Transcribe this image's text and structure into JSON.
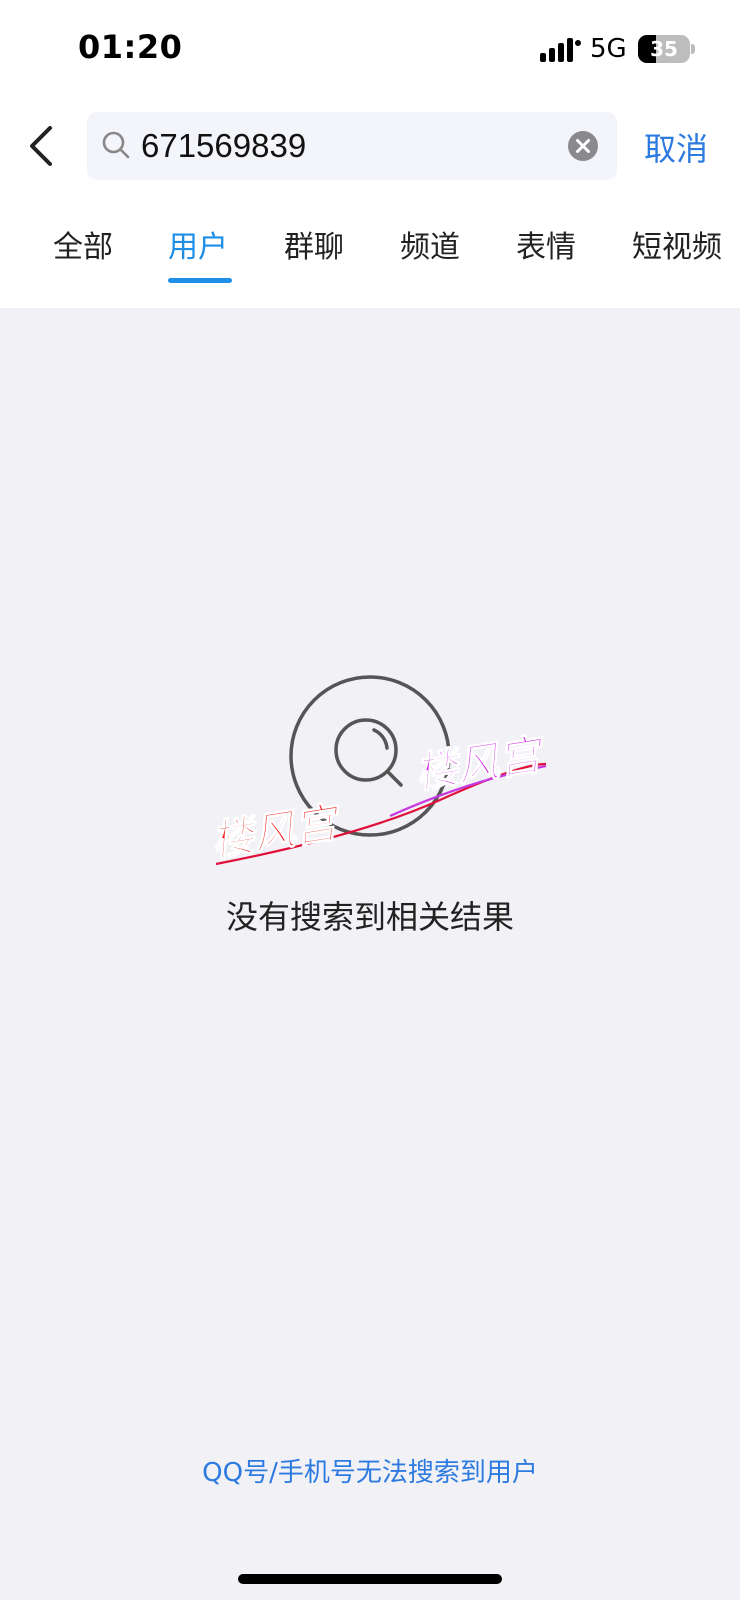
{
  "status_bar": {
    "time": "01:20",
    "network": "5G",
    "battery_level": 35,
    "battery_label": "35"
  },
  "search": {
    "query": "671569839",
    "cancel_label": "取消"
  },
  "tabs": [
    {
      "label": "全部",
      "active": false
    },
    {
      "label": "用户",
      "active": true
    },
    {
      "label": "群聊",
      "active": false
    },
    {
      "label": "频道",
      "active": false
    },
    {
      "label": "表情",
      "active": false
    },
    {
      "label": "短视频",
      "active": false
    }
  ],
  "empty_state": {
    "message": "没有搜索到相关结果",
    "hint": "QQ号/手机号无法搜索到用户"
  },
  "watermark": {
    "text_left": "楼风宫",
    "text_right": "楼风宫"
  },
  "colors": {
    "accent": "#1e8ee6",
    "link": "#2d7be0",
    "background": "#f2f2f6"
  }
}
